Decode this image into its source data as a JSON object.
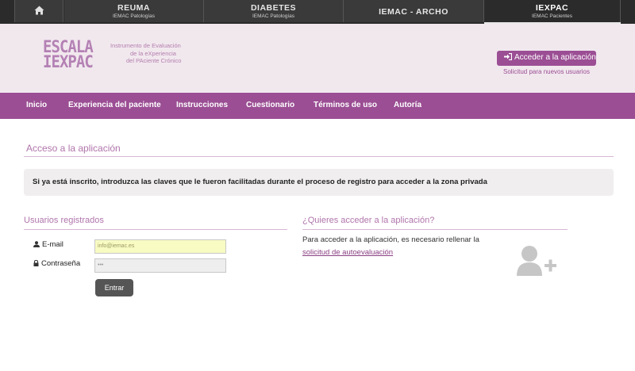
{
  "topbar": {
    "home_icon": "home-icon",
    "tabs": [
      {
        "title": "REUMA",
        "subtitle": "IEMAC Patologías"
      },
      {
        "title": "DIABETES",
        "subtitle": "IEMAC Patologías"
      },
      {
        "title": "IEMAC - ARCHO",
        "subtitle": ""
      },
      {
        "title": "IEXPAC",
        "subtitle": "IEMAC Pacientes",
        "active": true
      }
    ]
  },
  "header": {
    "logo_line1": "ESCALA",
    "logo_line2": "IEXPAC",
    "tagline": [
      "Instrumento de Evaluación",
      "de la eXperiencia",
      "del PAciente Crónico"
    ],
    "access_button": "Acceder a la aplicación",
    "access_icon": "sign-in-icon",
    "new_users_link": "Solicitud para nuevos usuarios"
  },
  "nav": {
    "items": [
      "Inicio",
      "Experiencia del paciente",
      "Instrucciones",
      "Cuestionario",
      "Términos de uso",
      "Autoría"
    ]
  },
  "main": {
    "title": "Acceso a la aplicación",
    "info": "Si ya está inscrito, introduzca las claves que le fueron facilitadas durante el proceso de registro para acceder a la zona privada",
    "registered": {
      "title": "Usuarios registrados",
      "email_label": "E-mail",
      "email_value": "info@iemac.es",
      "password_label": "Contraseña",
      "password_value": "•••",
      "submit": "Entrar"
    },
    "signup": {
      "title": "¿Quieres acceder a la aplicación?",
      "text": "Para acceder a la aplicación, es necesario rellenar la",
      "link": "solicitud de autoevaluación",
      "icon": "add-user-icon"
    }
  },
  "colors": {
    "brand": "#9b4e94",
    "header_bg": "#f1e8ee",
    "topbar_bg": "#2b2b2b",
    "email_field_bg": "#f8fbc2"
  }
}
